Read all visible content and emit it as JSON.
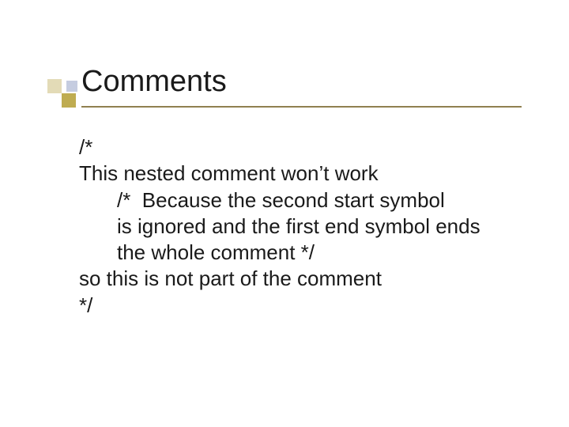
{
  "slide": {
    "title": "Comments",
    "lines": {
      "l1": "/*",
      "l2": "This nested comment won’t work",
      "l3": "/*  Because the second start symbol",
      "l4": "is ignored and the first end symbol ends",
      "l5": "the whole comment */",
      "l6": "so this is not part of the comment",
      "l7": "*/"
    }
  }
}
